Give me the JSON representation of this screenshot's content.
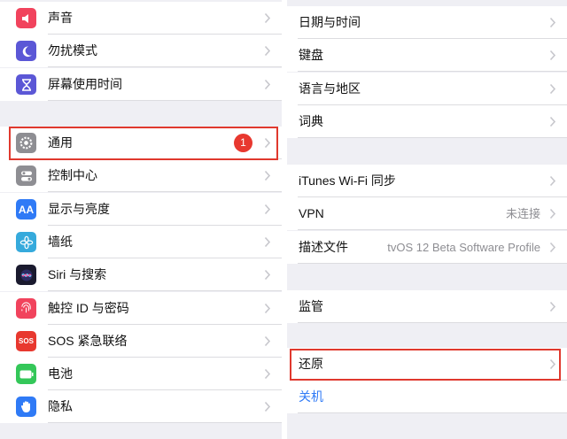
{
  "left": {
    "group1": [
      {
        "id": "sound",
        "label": "声音",
        "icon": "speaker-icon",
        "color": "#f1435d"
      },
      {
        "id": "dnd",
        "label": "勿扰模式",
        "icon": "moon-icon",
        "color": "#5b57d6"
      },
      {
        "id": "screen-time",
        "label": "屏幕使用时间",
        "icon": "hourglass-icon",
        "color": "#5b57d6"
      }
    ],
    "group2": [
      {
        "id": "general",
        "label": "通用",
        "icon": "gear-icon",
        "color": "#8e8e93",
        "badge": "1"
      },
      {
        "id": "control-center",
        "label": "控制中心",
        "icon": "toggles-icon",
        "color": "#8e8e93"
      },
      {
        "id": "display",
        "label": "显示与亮度",
        "icon": "text-size-icon",
        "color": "#2f7af6",
        "icon_text": "AA"
      },
      {
        "id": "wallpaper",
        "label": "墙纸",
        "icon": "flower-icon",
        "color": "#36aadc"
      },
      {
        "id": "siri",
        "label": "Siri 与搜索",
        "icon": "siri-icon",
        "color": "#1a1a2e"
      },
      {
        "id": "touch-id",
        "label": "触控 ID 与密码",
        "icon": "fingerprint-icon",
        "color": "#f1435d"
      },
      {
        "id": "sos",
        "label": "SOS 紧急联络",
        "icon": "sos-icon",
        "color": "#e8382f",
        "icon_text": "SOS"
      },
      {
        "id": "battery",
        "label": "电池",
        "icon": "battery-icon",
        "color": "#34c759"
      },
      {
        "id": "privacy",
        "label": "隐私",
        "icon": "hand-icon",
        "color": "#2f7af6"
      }
    ]
  },
  "right": {
    "group1": [
      {
        "id": "date-time",
        "label": "日期与时间"
      },
      {
        "id": "keyboard",
        "label": "键盘"
      },
      {
        "id": "language-region",
        "label": "语言与地区"
      },
      {
        "id": "dictionary",
        "label": "词典"
      }
    ],
    "group2": [
      {
        "id": "itunes-sync",
        "label": "iTunes Wi-Fi 同步"
      },
      {
        "id": "vpn",
        "label": "VPN",
        "detail": "未连接"
      },
      {
        "id": "profile",
        "label": "描述文件",
        "detail": "tvOS 12 Beta Software Profile"
      }
    ],
    "group3": [
      {
        "id": "supervision",
        "label": "监管"
      }
    ],
    "group4": [
      {
        "id": "reset",
        "label": "还原"
      },
      {
        "id": "shutdown",
        "label": "关机",
        "link": true
      }
    ]
  },
  "colors": {
    "highlight": "#e0392e",
    "link": "#2f7af6",
    "background": "#efeff4"
  }
}
